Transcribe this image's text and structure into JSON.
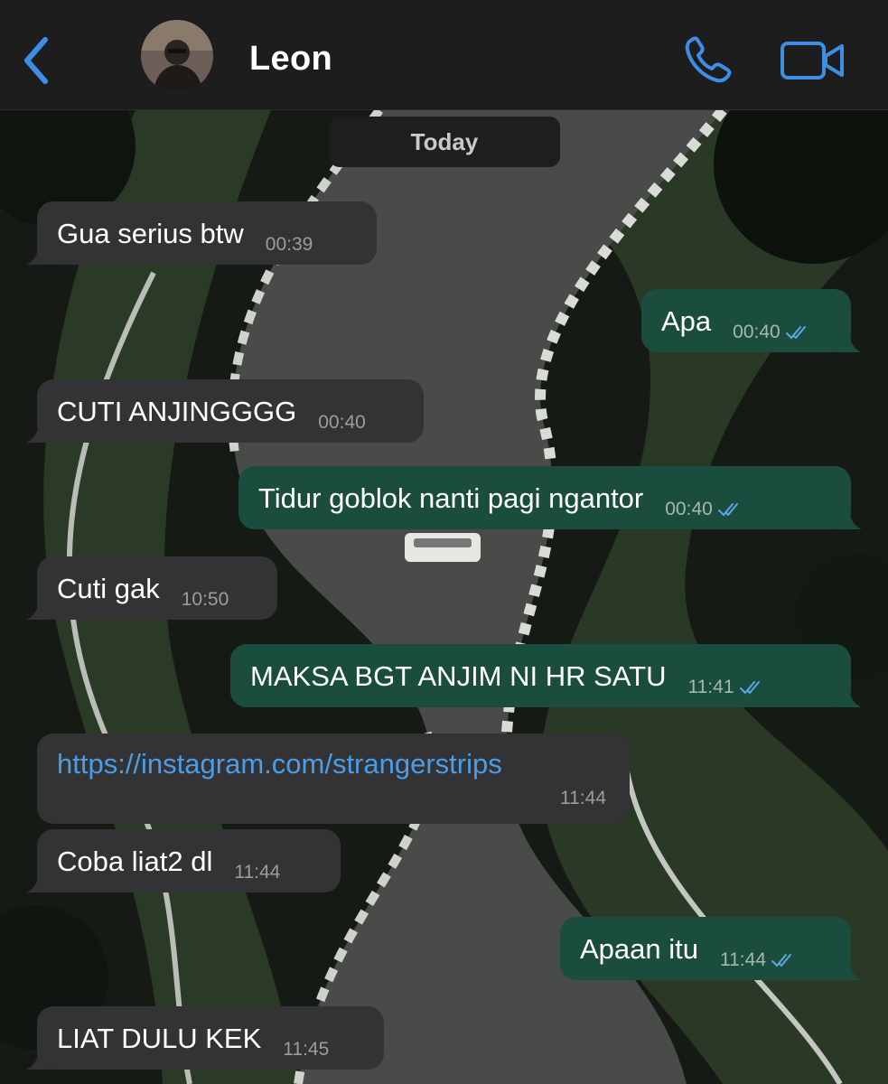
{
  "header": {
    "contact_name": "Leon",
    "back_icon": "chevron-left-icon",
    "call_icon": "phone-icon",
    "video_icon": "video-camera-icon",
    "accent_color": "#3d8fe6"
  },
  "date_label": "Today",
  "messages": [
    {
      "direction": "incoming",
      "text": "Gua serius btw",
      "time": "00:39"
    },
    {
      "direction": "outgoing",
      "text": "Apa",
      "time": "00:40",
      "status": "read"
    },
    {
      "direction": "incoming",
      "text": "CUTI ANJINGGGG",
      "time": "00:40"
    },
    {
      "direction": "outgoing",
      "text": "Tidur goblok nanti pagi ngantor",
      "time": "00:40",
      "status": "read"
    },
    {
      "direction": "incoming",
      "text": "Cuti gak",
      "time": "10:50"
    },
    {
      "direction": "outgoing",
      "text": "MAKSA BGT ANJIM NI HR SATU",
      "time": "11:41",
      "status": "read"
    },
    {
      "direction": "incoming",
      "text": "https://instagram.com/strangerstrips",
      "time": "11:44",
      "is_link": true
    },
    {
      "direction": "incoming",
      "text": "Coba liat2 dl",
      "time": "11:44"
    },
    {
      "direction": "outgoing",
      "text": "Apaan itu",
      "time": "11:44",
      "status": "read"
    },
    {
      "direction": "incoming",
      "text": "LIAT DULU KEK",
      "time": "11:45"
    }
  ],
  "colors": {
    "incoming_bubble": "#333336",
    "outgoing_bubble": "#1b4d3e",
    "link": "#4a9de6",
    "read_ticks": "#5aa7e6"
  }
}
